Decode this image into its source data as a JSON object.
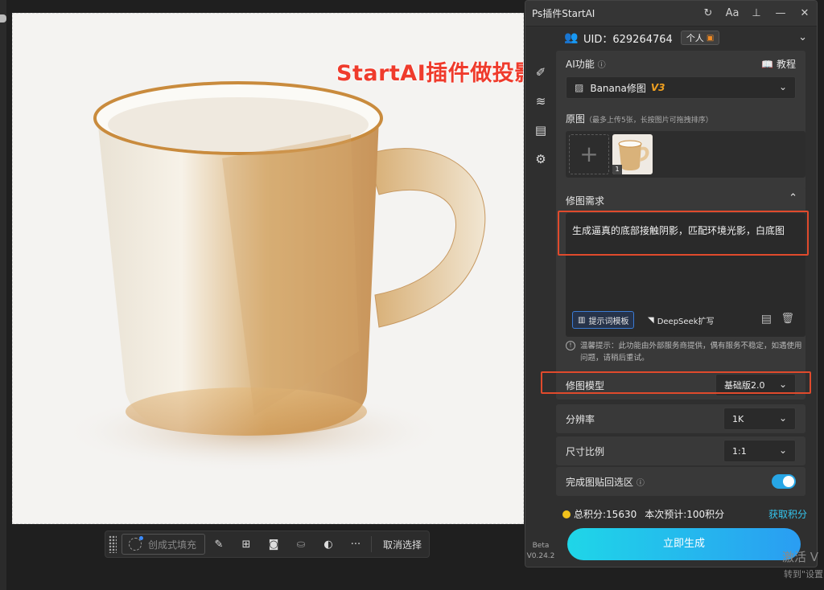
{
  "overlay_title": "StartAI插件做投影效果",
  "context_bar": {
    "fill_label": "创成式填充",
    "cancel_label": "取消选择",
    "more_label": "···"
  },
  "panel": {
    "title": "Ps插件StartAI",
    "version_beta": "Beta",
    "version": "V0.24.2",
    "uid_label": "UID：629264764",
    "account_type": "个人",
    "ai_function_label": "AI功能",
    "tutorial_label": "教程",
    "model_select": {
      "name": "Banana修图",
      "tag": "V3"
    },
    "original": {
      "label": "原图",
      "note": "（最多上传5张，长按图片可拖拽排序）",
      "thumb_index": "1"
    },
    "edit_requirement": {
      "label": "修图需求",
      "prompt": "生成逼真的底部接触阴影，匹配环境光影，白底图",
      "template_chip": "提示词模板",
      "deepseek_chip": "DeepSeek扩写"
    },
    "hint": "温馨提示：此功能由外部服务商提供，偶有服务不稳定，如遇使用问题，请稍后重试。",
    "edit_model": {
      "label": "修图模型",
      "value": "基础版2.0"
    },
    "resolution": {
      "label": "分辨率",
      "value": "1K"
    },
    "aspect_ratio": {
      "label": "尺寸比例",
      "value": "1:1"
    },
    "paste_back": {
      "label": "完成图贴回选区",
      "enabled": true
    },
    "points": {
      "total": "总积分:15630",
      "estimate": "本次预计:100积分",
      "get_label": "获取积分"
    },
    "generate_label": "立即生成"
  },
  "watermark": {
    "line1": "激活 V",
    "line2": "转到\"设置"
  },
  "colors": {
    "accent": "#27a6e6",
    "highlight": "#e04a2c",
    "title_red": "#ef3b2c"
  }
}
